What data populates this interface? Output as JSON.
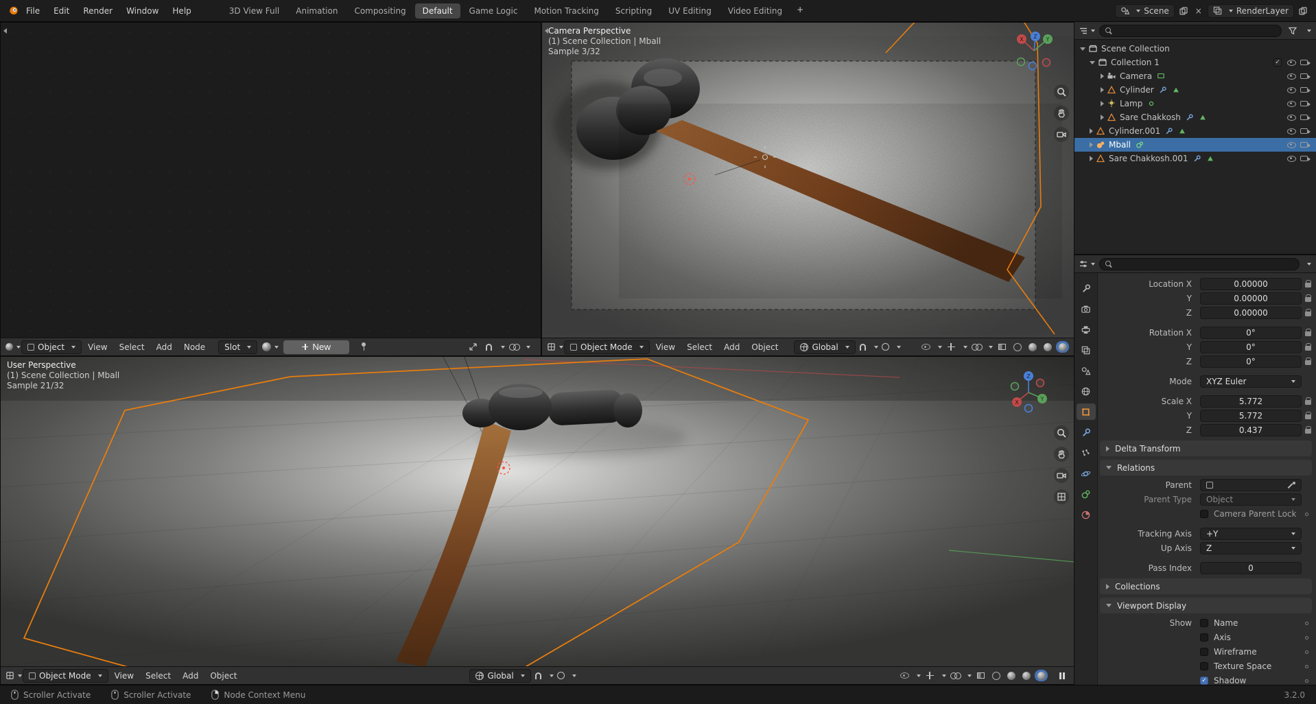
{
  "gizmo": {
    "x": "X",
    "y": "Y",
    "z": "Z"
  },
  "topbar": {
    "menus": [
      {
        "label": "File"
      },
      {
        "label": "Edit"
      },
      {
        "label": "Render"
      },
      {
        "label": "Window"
      },
      {
        "label": "Help"
      }
    ],
    "workspaces": [
      {
        "label": "3D View Full"
      },
      {
        "label": "Animation"
      },
      {
        "label": "Compositing"
      },
      {
        "label": "Default"
      },
      {
        "label": "Game Logic"
      },
      {
        "label": "Motion Tracking"
      },
      {
        "label": "Scripting"
      },
      {
        "label": "UV Editing"
      },
      {
        "label": "Video Editing"
      }
    ],
    "active_workspace": "Default",
    "add_workspace_label": "+",
    "scene_name": "Scene",
    "render_layer_name": "RenderLayer"
  },
  "shader_editor": {
    "header": {
      "object_type_label": "Object",
      "view_label": "View",
      "select_label": "Select",
      "add_label": "Add",
      "node_label": "Node",
      "slot_label": "Slot",
      "new_button_label": "New"
    }
  },
  "camera_viewport": {
    "view_label": "Camera Perspective",
    "context_label": "(1) Scene Collection | Mball",
    "sample_label": "Sample 3/32",
    "header": {
      "mode_label": "Object Mode",
      "view_label": "View",
      "select_label": "Select",
      "add_label": "Add",
      "object_label": "Object",
      "orientation_label": "Global"
    }
  },
  "user_viewport": {
    "view_label": "User Perspective",
    "context_label": "(1) Scene Collection | Mball",
    "sample_label": "Sample 21/32",
    "header": {
      "mode_label": "Object Mode",
      "view_label": "View",
      "select_label": "Select",
      "add_label": "Add",
      "object_label": "Object",
      "orientation_label": "Global"
    }
  },
  "outliner": {
    "root_label": "Scene Collection",
    "rows": [
      {
        "label": "Collection 1",
        "type": "collection",
        "selected": false
      },
      {
        "label": "Camera",
        "type": "camera",
        "selected": false
      },
      {
        "label": "Cylinder",
        "type": "mesh",
        "selected": false
      },
      {
        "label": "Lamp",
        "type": "light",
        "selected": false
      },
      {
        "label": "Sare Chakkosh",
        "type": "mesh",
        "selected": false
      },
      {
        "label": "Cylinder.001",
        "type": "mesh",
        "selected": false
      },
      {
        "label": "Mball",
        "type": "metaball",
        "selected": true
      },
      {
        "label": "Sare Chakkosh.001",
        "type": "mesh",
        "selected": false
      }
    ]
  },
  "properties": {
    "location": {
      "x_label": "Location X",
      "y_label": "Y",
      "z_label": "Z",
      "x": "0.00000",
      "y": "0.00000",
      "z": "0.00000"
    },
    "rotation": {
      "x_label": "Rotation X",
      "y_label": "Y",
      "z_label": "Z",
      "x": "0°",
      "y": "0°",
      "z": "0°"
    },
    "mode": {
      "label": "Mode",
      "value": "XYZ Euler"
    },
    "scale": {
      "x_label": "Scale X",
      "y_label": "Y",
      "z_label": "Z",
      "x": "5.772",
      "y": "5.772",
      "z": "0.437"
    },
    "sections": {
      "delta_transform": "Delta Transform",
      "relations": "Relations",
      "collections": "Collections",
      "viewport_display": "Viewport Display"
    },
    "relations": {
      "parent_label": "Parent",
      "parent_type_label": "Parent Type",
      "parent_type_value": "Object",
      "camera_parent_lock_label": "Camera Parent Lock",
      "tracking_axis_label": "Tracking Axis",
      "tracking_axis_value": "+Y",
      "up_axis_label": "Up Axis",
      "up_axis_value": "Z",
      "pass_index_label": "Pass Index",
      "pass_index_value": "0"
    },
    "viewport_display": {
      "show_label": "Show",
      "options": [
        {
          "label": "Name",
          "checked": false
        },
        {
          "label": "Axis",
          "checked": false
        },
        {
          "label": "Wireframe",
          "checked": false
        },
        {
          "label": "Texture Space",
          "checked": false
        },
        {
          "label": "Shadow",
          "checked": true
        }
      ]
    }
  },
  "statusbar": {
    "hints": [
      {
        "label": "Scroller Activate"
      },
      {
        "label": "Scroller Activate"
      },
      {
        "label": "Node Context Menu"
      }
    ],
    "version": "3.2.0"
  },
  "colors": {
    "accent_orange": "#e87d0d",
    "selection_blue": "#3b6ea5",
    "check_blue": "#4772b3",
    "outline_red": "#ff5545"
  }
}
